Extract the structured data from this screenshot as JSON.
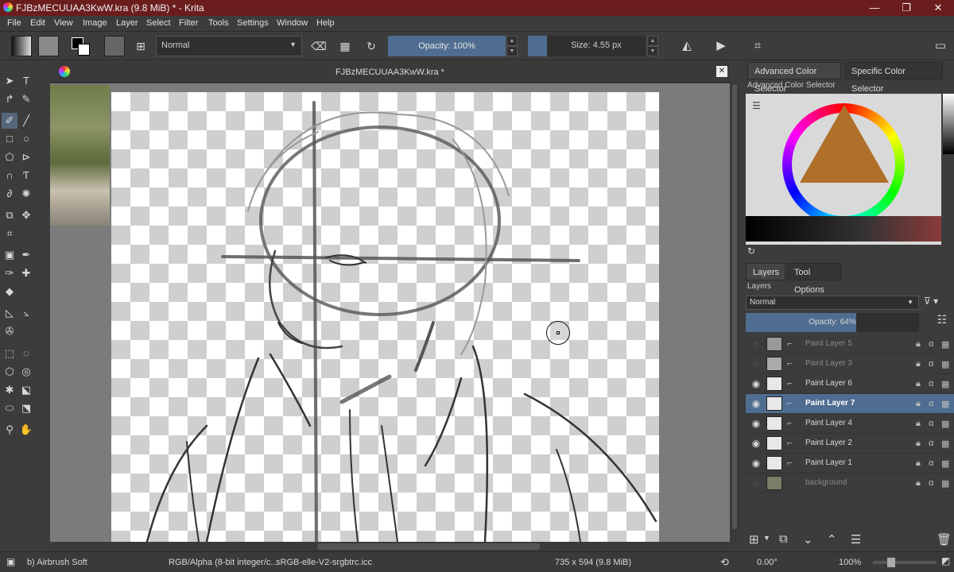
{
  "window": {
    "title": "FJBzMECUUAA3KwW.kra (9.8 MiB)  * - Krita",
    "min": "—",
    "max": "❐",
    "close": "✕"
  },
  "menu": [
    "File",
    "Edit",
    "View",
    "Image",
    "Layer",
    "Select",
    "Filter",
    "Tools",
    "Settings",
    "Window",
    "Help"
  ],
  "toolbar": {
    "blend_mode": "Normal",
    "opacity": "Opacity: 100%",
    "size": "Size: 4.55 px"
  },
  "document": {
    "tab_title": "FJBzMECUUAA3KwW.kra *",
    "close": "✕"
  },
  "dock": {
    "tabs": [
      "Advanced Color Selector",
      "Specific Color Selector"
    ],
    "color_panel_title": "Advanced Color Selector",
    "layer_tabs": [
      "Layers",
      "Tool Options"
    ],
    "layers_title": "Layers",
    "blend_mode": "Normal",
    "opacity": "Opacity:  64%",
    "layers": [
      {
        "name": "Paint Layer 5",
        "visible": false,
        "selected": false
      },
      {
        "name": "Paint Layer 3",
        "visible": false,
        "selected": false
      },
      {
        "name": "Paint Layer 6",
        "visible": true,
        "selected": false
      },
      {
        "name": "Paint Layer 7",
        "visible": true,
        "selected": true
      },
      {
        "name": "Paint Layer 4",
        "visible": true,
        "selected": false
      },
      {
        "name": "Paint Layer 2",
        "visible": true,
        "selected": false
      },
      {
        "name": "Paint Layer 1",
        "visible": true,
        "selected": false
      },
      {
        "name": "background",
        "visible": false,
        "selected": false
      }
    ]
  },
  "status": {
    "brush": "b) Airbrush Soft",
    "colorspace": "RGB/Alpha (8-bit integer/c...",
    "profile": "sRGB-elle-V2-srgbtrc.icc",
    "dimensions": "735 x 594 (9.8 MiB)",
    "rotation": "0.00°",
    "zoom": "100%"
  },
  "colors": {
    "titlebar": "#6b1d1d",
    "accent": "#4f6d90",
    "panel": "#3c3c3c"
  }
}
